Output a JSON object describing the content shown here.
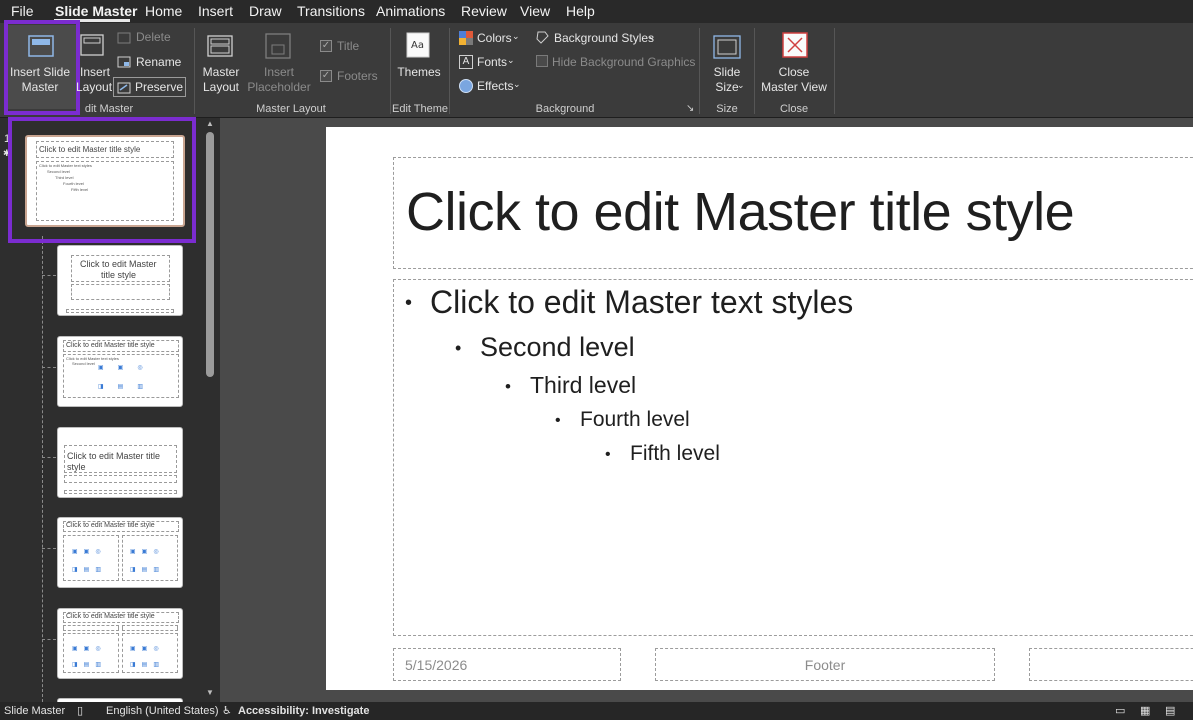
{
  "menu": {
    "items": [
      "File",
      "Slide Master",
      "Home",
      "Insert",
      "Draw",
      "Transitions",
      "Animations",
      "Review",
      "View",
      "Help"
    ]
  },
  "ribbon": {
    "insert_slide_master": "Insert Slide Master",
    "insert_slide_master_l1": "Insert Slide",
    "insert_slide_master_l2": "Master",
    "insert_layout_l1": "Insert",
    "insert_layout_l2": "Layout",
    "delete": "Delete",
    "rename": "Rename",
    "preserve": "Preserve",
    "edit_master_group": "Edit Master",
    "edit_master_group_visible": "dit Master",
    "master_layout_l1": "Master",
    "master_layout_l2": "Layout",
    "insert_placeholder_l1": "Insert",
    "insert_placeholder_l2": "Placeholder",
    "title_check": "Title",
    "footers_check": "Footers",
    "master_layout_group": "Master Layout",
    "themes": "Themes",
    "edit_theme_group": "Edit Theme",
    "colors": "Colors",
    "fonts": "Fonts",
    "effects": "Effects",
    "background_styles": "Background Styles",
    "hide_background_graphics": "Hide Background Graphics",
    "background_group": "Background",
    "slide_size_l1": "Slide",
    "slide_size_l2": "Size",
    "size_group": "Size",
    "close_master_view_l1": "Close",
    "close_master_view_l2": "Master View",
    "close_group": "Close",
    "highlight_color": "#7b2cd0"
  },
  "thumbnails": {
    "slide_number": "1",
    "master_title": "Click to edit Master title style",
    "master_text": "Click to edit Master text styles",
    "second": "Second level",
    "third": "Third level",
    "fourth": "Fourth level",
    "fifth": "Fifth level",
    "layout2_title_l1": "Click to edit Master",
    "layout2_title_l2": "title style",
    "layout3_title": "Click to edit Master title style",
    "layout4_title_l1": "Click to edit Master title",
    "layout4_title_l2": "style",
    "layout5_title": "Click to edit Master title style",
    "layout6_title": "Click to edit Master title style"
  },
  "slide": {
    "title": "Click to edit Master title style",
    "level1": "Click to edit Master text styles",
    "level2": "Second level",
    "level3": "Third level",
    "level4": "Fourth level",
    "level5": "Fifth level",
    "date": "5/15/2026",
    "footer": "Footer"
  },
  "status": {
    "view": "Slide Master",
    "language": "English (United States)",
    "accessibility": "Accessibility: Investigate"
  }
}
